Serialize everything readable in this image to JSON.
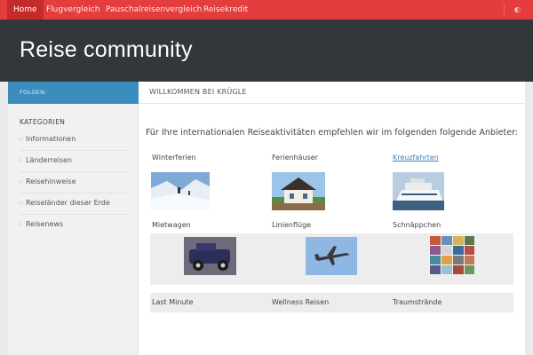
{
  "nav": {
    "items": [
      {
        "label": "Home",
        "active": true
      },
      {
        "label": "Flugvergleich",
        "active": false
      },
      {
        "label": "Pauschalreisenvergleich",
        "active": false
      },
      {
        "label": "Reisekredit",
        "active": false
      }
    ],
    "social_icon": "rss-icon",
    "social_glyph": "◐"
  },
  "header": {
    "title": "Reise community"
  },
  "sidebar": {
    "follow_label": "FOLGEN:",
    "categories_title": "KATEGORIEN",
    "categories": [
      {
        "label": "Informationen"
      },
      {
        "label": "Länderreisen"
      },
      {
        "label": "Reisehinweise"
      },
      {
        "label": "Reiseländer dieser Erde"
      },
      {
        "label": "Reisenews"
      }
    ]
  },
  "main": {
    "page_title": "WILLKOMMEN BEI KRÜGLE",
    "intro": "Für Ihre internationalen Reiseaktivitäten empfehlen wir im folgenden folgende Anbieter:",
    "offers": [
      {
        "label": "Winterferien",
        "image": "ski-slope-photo"
      },
      {
        "label": "Ferienhäuser",
        "image": "holiday-house-photo"
      },
      {
        "label": "Kreuzfahrten",
        "image": "cruise-ship-photo",
        "link": true
      },
      {
        "label": "Mietwagen",
        "image": "classic-car-photo"
      },
      {
        "label": "Linienflüge",
        "image": "airplane-photo"
      },
      {
        "label": "Schnäppchen",
        "image": "collage-photo"
      },
      {
        "label": "Last Minute"
      },
      {
        "label": "Wellness Reisen"
      },
      {
        "label": "Traumstrände"
      }
    ]
  },
  "colors": {
    "nav_red": "#e33d3d",
    "header_dark": "#33363b",
    "accent_blue": "#3b8dbd",
    "link_blue": "#3b80b6"
  }
}
